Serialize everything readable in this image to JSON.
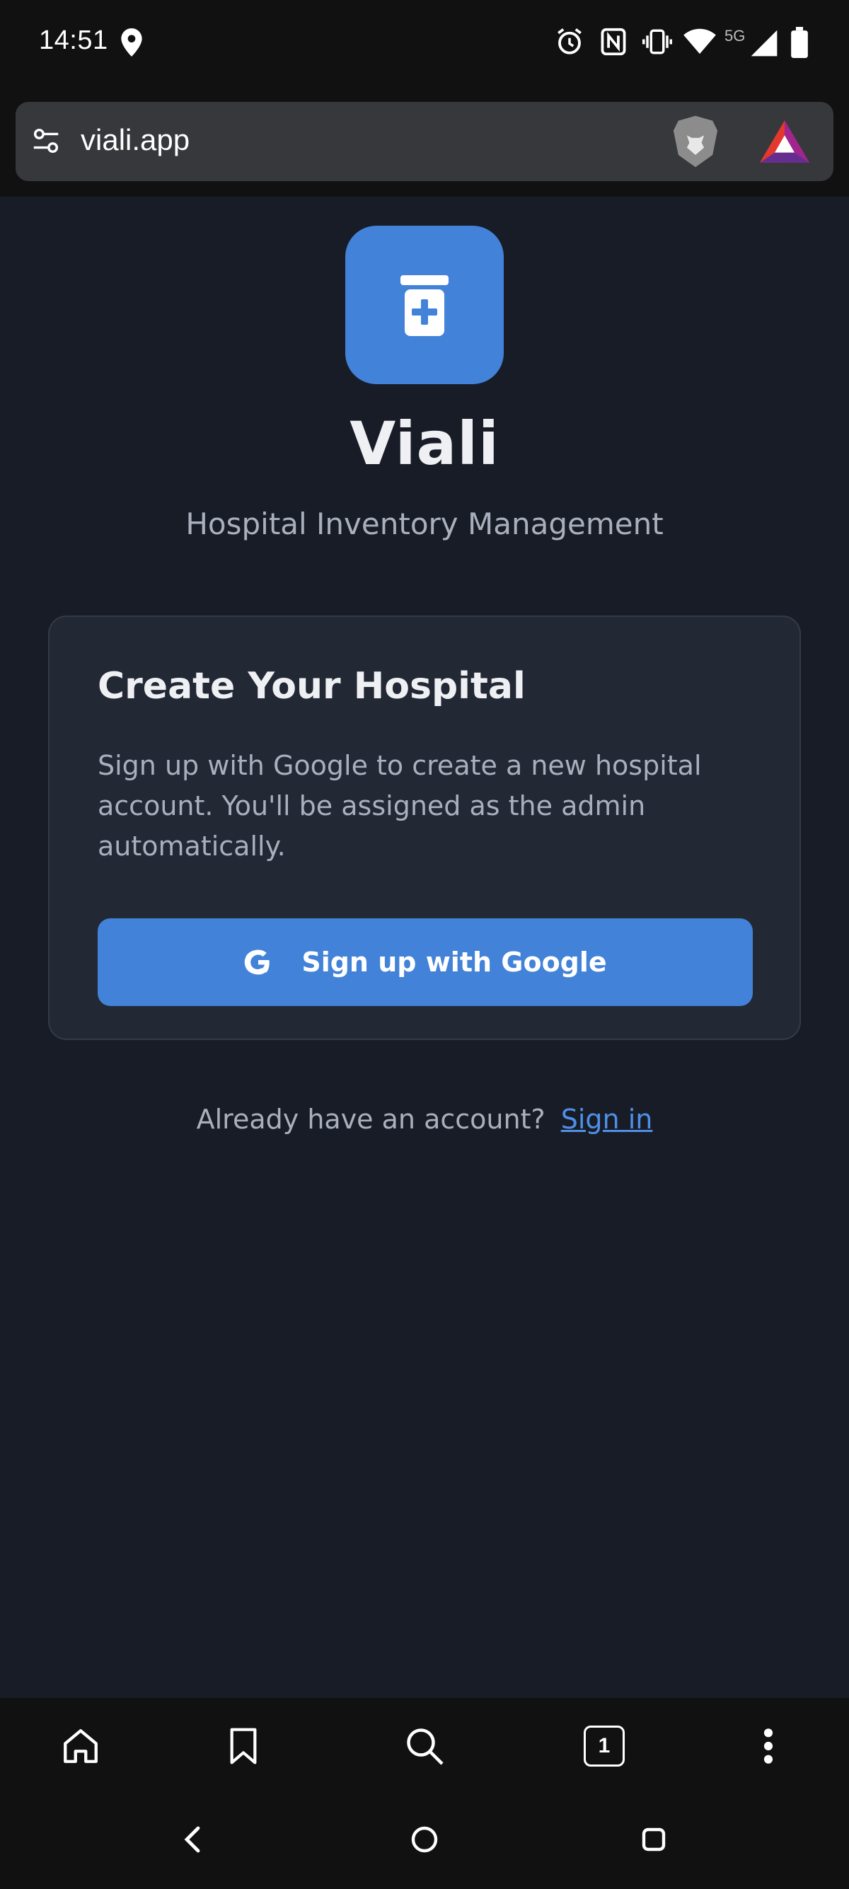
{
  "status_bar": {
    "time": "14:51",
    "network": "5G"
  },
  "browser": {
    "url": "viali.app"
  },
  "app": {
    "name": "Viali",
    "subtitle": "Hospital Inventory Management",
    "accent_color": "#4282d8"
  },
  "card": {
    "title": "Create Your Hospital",
    "body": "Sign up with Google to create a new hospital account. You'll be assigned as the admin automatically.",
    "button_label": "Sign up with Google"
  },
  "signin": {
    "prompt": "Already have an account?",
    "link_label": "Sign in"
  },
  "bottom_nav": {
    "tab_count": "1",
    "icons": [
      "home-icon",
      "bookmark-icon",
      "search-icon",
      "tabs-icon",
      "more-icon"
    ]
  },
  "system_nav": {
    "icons": [
      "back-icon",
      "home-circle-icon",
      "recents-icon"
    ]
  }
}
